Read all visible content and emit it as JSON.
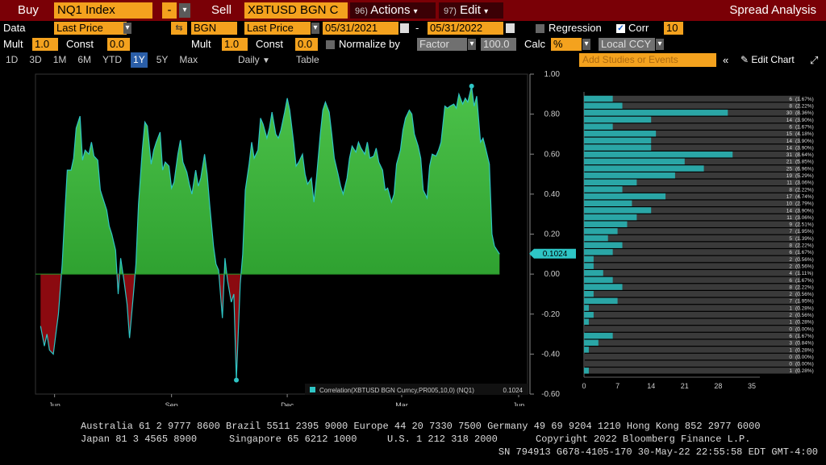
{
  "toolbar": {
    "buy_label": "Buy",
    "buy_ticker": "NQ1 Index",
    "minus_label": "-",
    "sell_label": "Sell",
    "sell_ticker": "XBTUSD BGN C",
    "actions_num": "96)",
    "actions_label": "Actions",
    "edit_num": "97)",
    "edit_label": "Edit",
    "title": "Spread Analysis"
  },
  "row2": {
    "data_label": "Data",
    "field1": "Last Price",
    "source": "BGN",
    "field2": "Last Price",
    "start_date": "05/31/2021",
    "dash": "-",
    "end_date": "05/31/2022",
    "regression_label": "Regression",
    "corr_label": "Corr",
    "corr_value": "10"
  },
  "row3": {
    "mult_label": "Mult",
    "mult1": "1.0",
    "const_label": "Const",
    "const1": "0.0",
    "mult2": "1.0",
    "const2": "0.0",
    "normalize_label": "Normalize by",
    "normalize_value": "Factor",
    "factor_value": "100.0",
    "calc_label": "Calc",
    "calc_value": "%",
    "ccy_value": "Local CCY"
  },
  "row4": {
    "periods": [
      "1D",
      "3D",
      "1M",
      "6M",
      "YTD",
      "1Y",
      "5Y",
      "Max"
    ],
    "selected_period": "1Y",
    "frequency": "Daily",
    "table_label": "Table",
    "studies_placeholder": "Add Studies or Events",
    "edit_chart_label": "Edit Chart"
  },
  "chart_data": [
    {
      "type": "area",
      "legend_label": "Correlation(XBTUSD BGN Curncy,PR005,10,0) (NQ1)",
      "legend_value": "0.1024",
      "current_value_tag": "0.1024",
      "ylim": [
        -0.6,
        1.0
      ],
      "y_ticks": [
        "1.00",
        "0.80",
        "0.60",
        "0.40",
        "0.20",
        "0.00",
        "-0.20",
        "-0.40",
        "-0.60"
      ],
      "x_ticks": [
        {
          "label": "Jun",
          "year": ""
        },
        {
          "label": "Sep",
          "year": "2021"
        },
        {
          "label": "Dec",
          "year": ""
        },
        {
          "label": "Mar",
          "year": "2022"
        },
        {
          "label": "Jun",
          "year": ""
        }
      ],
      "x_start": "2021-05-31",
      "x_end": "2022-06-22",
      "positive_color": "#1f8f22",
      "negative_color": "#8b0a10",
      "line_color": "#2ec5c5",
      "series": [
        [
          "2021-06-04",
          -0.26
        ],
        [
          "2021-06-07",
          -0.36
        ],
        [
          "2021-06-09",
          -0.3
        ],
        [
          "2021-06-11",
          -0.38
        ],
        [
          "2021-06-14",
          -0.4
        ],
        [
          "2021-06-16",
          -0.3
        ],
        [
          "2021-06-18",
          -0.2
        ],
        [
          "2021-06-21",
          0.05
        ],
        [
          "2021-06-23",
          0.3
        ],
        [
          "2021-06-25",
          0.52
        ],
        [
          "2021-06-28",
          0.52
        ],
        [
          "2021-06-30",
          0.58
        ],
        [
          "2021-07-02",
          0.73
        ],
        [
          "2021-07-05",
          0.79
        ],
        [
          "2021-07-07",
          0.57
        ],
        [
          "2021-07-09",
          0.62
        ],
        [
          "2021-07-12",
          0.6
        ],
        [
          "2021-07-14",
          0.66
        ],
        [
          "2021-07-16",
          0.59
        ],
        [
          "2021-07-19",
          0.57
        ],
        [
          "2021-07-21",
          0.42
        ],
        [
          "2021-07-23",
          0.38
        ],
        [
          "2021-07-26",
          0.32
        ],
        [
          "2021-07-28",
          0.24
        ],
        [
          "2021-07-30",
          0.2
        ],
        [
          "2021-08-02",
          0.12
        ],
        [
          "2021-08-04",
          -0.1
        ],
        [
          "2021-08-06",
          0.08
        ],
        [
          "2021-08-09",
          -0.05
        ],
        [
          "2021-08-11",
          -0.15
        ],
        [
          "2021-08-13",
          -0.32
        ],
        [
          "2021-08-16",
          -0.1
        ],
        [
          "2021-08-18",
          0.05
        ],
        [
          "2021-08-20",
          0.35
        ],
        [
          "2021-08-23",
          0.62
        ],
        [
          "2021-08-25",
          0.76
        ],
        [
          "2021-08-27",
          0.74
        ],
        [
          "2021-08-30",
          0.55
        ],
        [
          "2021-09-01",
          0.62
        ],
        [
          "2021-09-03",
          0.66
        ],
        [
          "2021-09-06",
          0.71
        ],
        [
          "2021-09-08",
          0.52
        ],
        [
          "2021-09-10",
          0.56
        ],
        [
          "2021-09-13",
          0.54
        ],
        [
          "2021-09-15",
          0.43
        ],
        [
          "2021-09-17",
          0.46
        ],
        [
          "2021-09-20",
          0.6
        ],
        [
          "2021-09-22",
          0.67
        ],
        [
          "2021-09-24",
          0.56
        ],
        [
          "2021-09-27",
          0.51
        ],
        [
          "2021-09-29",
          0.45
        ],
        [
          "2021-10-01",
          0.4
        ],
        [
          "2021-10-04",
          0.52
        ],
        [
          "2021-10-06",
          0.44
        ],
        [
          "2021-10-08",
          0.48
        ],
        [
          "2021-10-11",
          0.6
        ],
        [
          "2021-10-13",
          0.5
        ],
        [
          "2021-10-15",
          0.35
        ],
        [
          "2021-10-18",
          0.14
        ],
        [
          "2021-10-20",
          0.05
        ],
        [
          "2021-10-22",
          0.02
        ],
        [
          "2021-10-25",
          -0.22
        ],
        [
          "2021-10-27",
          0.08
        ],
        [
          "2021-10-29",
          -0.03
        ],
        [
          "2021-11-01",
          -0.14
        ],
        [
          "2021-11-03",
          -0.1
        ],
        [
          "2021-11-05",
          -0.53
        ],
        [
          "2021-11-08",
          -0.05
        ],
        [
          "2021-11-10",
          0.1
        ],
        [
          "2021-11-12",
          0.42
        ],
        [
          "2021-11-15",
          0.55
        ],
        [
          "2021-11-17",
          0.66
        ],
        [
          "2021-11-19",
          0.58
        ],
        [
          "2021-11-22",
          0.62
        ],
        [
          "2021-11-24",
          0.78
        ],
        [
          "2021-11-26",
          0.75
        ],
        [
          "2021-11-29",
          0.68
        ],
        [
          "2021-12-01",
          0.73
        ],
        [
          "2021-12-03",
          0.81
        ],
        [
          "2021-12-06",
          0.7
        ],
        [
          "2021-12-08",
          0.68
        ],
        [
          "2021-12-10",
          0.72
        ],
        [
          "2021-12-13",
          0.81
        ],
        [
          "2021-12-15",
          0.88
        ],
        [
          "2021-12-17",
          0.82
        ],
        [
          "2021-12-20",
          0.66
        ],
        [
          "2021-12-22",
          0.54
        ],
        [
          "2021-12-24",
          0.56
        ],
        [
          "2021-12-27",
          0.6
        ],
        [
          "2021-12-29",
          0.5
        ],
        [
          "2021-12-31",
          0.45
        ],
        [
          "2022-01-03",
          0.48
        ],
        [
          "2022-01-05",
          0.36
        ],
        [
          "2022-01-07",
          0.48
        ],
        [
          "2022-01-10",
          0.7
        ],
        [
          "2022-01-12",
          0.82
        ],
        [
          "2022-01-14",
          0.86
        ],
        [
          "2022-01-17",
          0.81
        ],
        [
          "2022-01-19",
          0.7
        ],
        [
          "2022-01-21",
          0.58
        ],
        [
          "2022-01-24",
          0.5
        ],
        [
          "2022-01-26",
          0.44
        ],
        [
          "2022-01-28",
          0.4
        ],
        [
          "2022-01-31",
          0.48
        ],
        [
          "2022-02-02",
          0.58
        ],
        [
          "2022-02-04",
          0.64
        ],
        [
          "2022-02-07",
          0.61
        ],
        [
          "2022-02-09",
          0.66
        ],
        [
          "2022-02-11",
          0.63
        ],
        [
          "2022-02-14",
          0.6
        ],
        [
          "2022-02-16",
          0.66
        ],
        [
          "2022-02-18",
          0.58
        ],
        [
          "2022-02-21",
          0.59
        ],
        [
          "2022-02-23",
          0.63
        ],
        [
          "2022-02-25",
          0.56
        ],
        [
          "2022-02-28",
          0.52
        ],
        [
          "2022-03-02",
          0.42
        ],
        [
          "2022-03-04",
          0.43
        ],
        [
          "2022-03-07",
          0.36
        ],
        [
          "2022-03-09",
          0.4
        ],
        [
          "2022-03-11",
          0.55
        ],
        [
          "2022-03-14",
          0.62
        ],
        [
          "2022-03-16",
          0.72
        ],
        [
          "2022-03-18",
          0.78
        ],
        [
          "2022-03-21",
          0.82
        ],
        [
          "2022-03-23",
          0.8
        ],
        [
          "2022-03-25",
          0.7
        ],
        [
          "2022-03-28",
          0.64
        ],
        [
          "2022-03-30",
          0.58
        ],
        [
          "2022-04-01",
          0.42
        ],
        [
          "2022-04-04",
          0.38
        ],
        [
          "2022-04-06",
          0.54
        ],
        [
          "2022-04-08",
          0.6
        ],
        [
          "2022-04-11",
          0.59
        ],
        [
          "2022-04-13",
          0.62
        ],
        [
          "2022-04-15",
          0.66
        ],
        [
          "2022-04-18",
          0.84
        ],
        [
          "2022-04-20",
          0.83
        ],
        [
          "2022-04-22",
          0.84
        ],
        [
          "2022-04-25",
          0.85
        ],
        [
          "2022-04-27",
          0.83
        ],
        [
          "2022-04-29",
          0.9
        ],
        [
          "2022-05-02",
          0.85
        ],
        [
          "2022-05-04",
          0.88
        ],
        [
          "2022-05-06",
          0.86
        ],
        [
          "2022-05-09",
          0.94
        ],
        [
          "2022-05-11",
          0.84
        ],
        [
          "2022-05-13",
          0.89
        ],
        [
          "2022-05-16",
          0.66
        ],
        [
          "2022-05-18",
          0.68
        ],
        [
          "2022-05-20",
          0.63
        ],
        [
          "2022-05-23",
          0.55
        ],
        [
          "2022-05-25",
          0.2
        ],
        [
          "2022-05-27",
          0.14
        ],
        [
          "2022-05-31",
          0.1
        ]
      ],
      "marker_high": [
        "2022-05-09",
        0.94
      ],
      "marker_low": [
        "2021-11-05",
        -0.53
      ]
    },
    {
      "type": "bar",
      "orientation": "horizontal",
      "x_ticks": [
        "0",
        "7",
        "14",
        "21",
        "28",
        "35"
      ],
      "xlim": [
        0,
        35
      ],
      "bar_color": "#2aa6a6",
      "rows": [
        {
          "count": 6,
          "pct": "(1.67%)"
        },
        {
          "count": 8,
          "pct": "(2.22%)"
        },
        {
          "count": 30,
          "pct": "(8.36%)"
        },
        {
          "count": 14,
          "pct": "(3.90%)"
        },
        {
          "count": 6,
          "pct": "(1.67%)"
        },
        {
          "count": 15,
          "pct": "(4.18%)"
        },
        {
          "count": 14,
          "pct": "(3.90%)"
        },
        {
          "count": 14,
          "pct": "(3.90%)"
        },
        {
          "count": 31,
          "pct": "(8.64%)"
        },
        {
          "count": 21,
          "pct": "(5.85%)"
        },
        {
          "count": 25,
          "pct": "(6.96%)"
        },
        {
          "count": 19,
          "pct": "(5.29%)"
        },
        {
          "count": 11,
          "pct": "(3.06%)"
        },
        {
          "count": 8,
          "pct": "(2.22%)"
        },
        {
          "count": 17,
          "pct": "(4.74%)"
        },
        {
          "count": 10,
          "pct": "(2.79%)"
        },
        {
          "count": 14,
          "pct": "(3.90%)"
        },
        {
          "count": 11,
          "pct": "(3.06%)"
        },
        {
          "count": 9,
          "pct": "(2.51%)"
        },
        {
          "count": 7,
          "pct": "(1.95%)"
        },
        {
          "count": 5,
          "pct": "(1.39%)"
        },
        {
          "count": 8,
          "pct": "(2.22%)"
        },
        {
          "count": 6,
          "pct": "(1.67%)"
        },
        {
          "count": 2,
          "pct": "(0.56%)"
        },
        {
          "count": 2,
          "pct": "(0.56%)"
        },
        {
          "count": 4,
          "pct": "(1.11%)"
        },
        {
          "count": 6,
          "pct": "(1.67%)"
        },
        {
          "count": 8,
          "pct": "(2.22%)"
        },
        {
          "count": 2,
          "pct": "(0.56%)"
        },
        {
          "count": 7,
          "pct": "(1.95%)"
        },
        {
          "count": 1,
          "pct": "(0.28%)"
        },
        {
          "count": 2,
          "pct": "(0.56%)"
        },
        {
          "count": 1,
          "pct": "(0.28%)"
        },
        {
          "count": 0,
          "pct": "(0.00%)"
        },
        {
          "count": 6,
          "pct": "(1.67%)"
        },
        {
          "count": 3,
          "pct": "(0.84%)"
        },
        {
          "count": 1,
          "pct": "(0.28%)"
        },
        {
          "count": 0,
          "pct": "(0.00%)"
        },
        {
          "count": 0,
          "pct": "(0.00%)"
        },
        {
          "count": 1,
          "pct": "(0.28%)"
        }
      ]
    }
  ],
  "footer": {
    "line1": "Australia 61 2 9777 8600 Brazil 5511 2395 9000 Europe 44 20 7330 7500 Germany 49 69 9204 1210 Hong Kong 852 2977 6000",
    "line2a": "Japan 81 3 4565 8900",
    "line2b": "Singapore 65 6212 1000",
    "line2c": "U.S. 1 212 318 2000",
    "line2d": "Copyright 2022 Bloomberg Finance L.P.",
    "line3": "SN 794913 G678-4105-170 30-May-22 22:55:58 EDT  GMT-4:00"
  }
}
